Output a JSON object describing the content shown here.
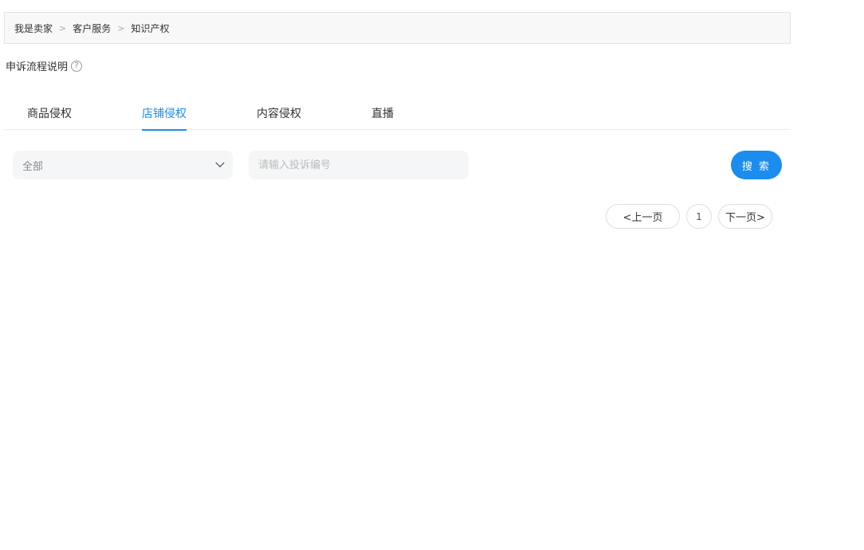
{
  "breadcrumb": {
    "items": [
      "我是卖家",
      "客户服务",
      "知识产权"
    ],
    "separator": ">"
  },
  "process": {
    "label": "申诉流程说明",
    "help_glyph": "?"
  },
  "tabs": [
    {
      "label": "商品侵权",
      "active": false
    },
    {
      "label": "店铺侵权",
      "active": true
    },
    {
      "label": "内容侵权",
      "active": false
    },
    {
      "label": "直播",
      "active": false
    }
  ],
  "filter": {
    "select_value": "全部",
    "search_placeholder": "请输入投诉编号",
    "search_button": "搜 索"
  },
  "pagination": {
    "prev": "<上一页",
    "current": "1",
    "next": "下一页>"
  },
  "colors": {
    "accent": "#1b8cf0"
  }
}
